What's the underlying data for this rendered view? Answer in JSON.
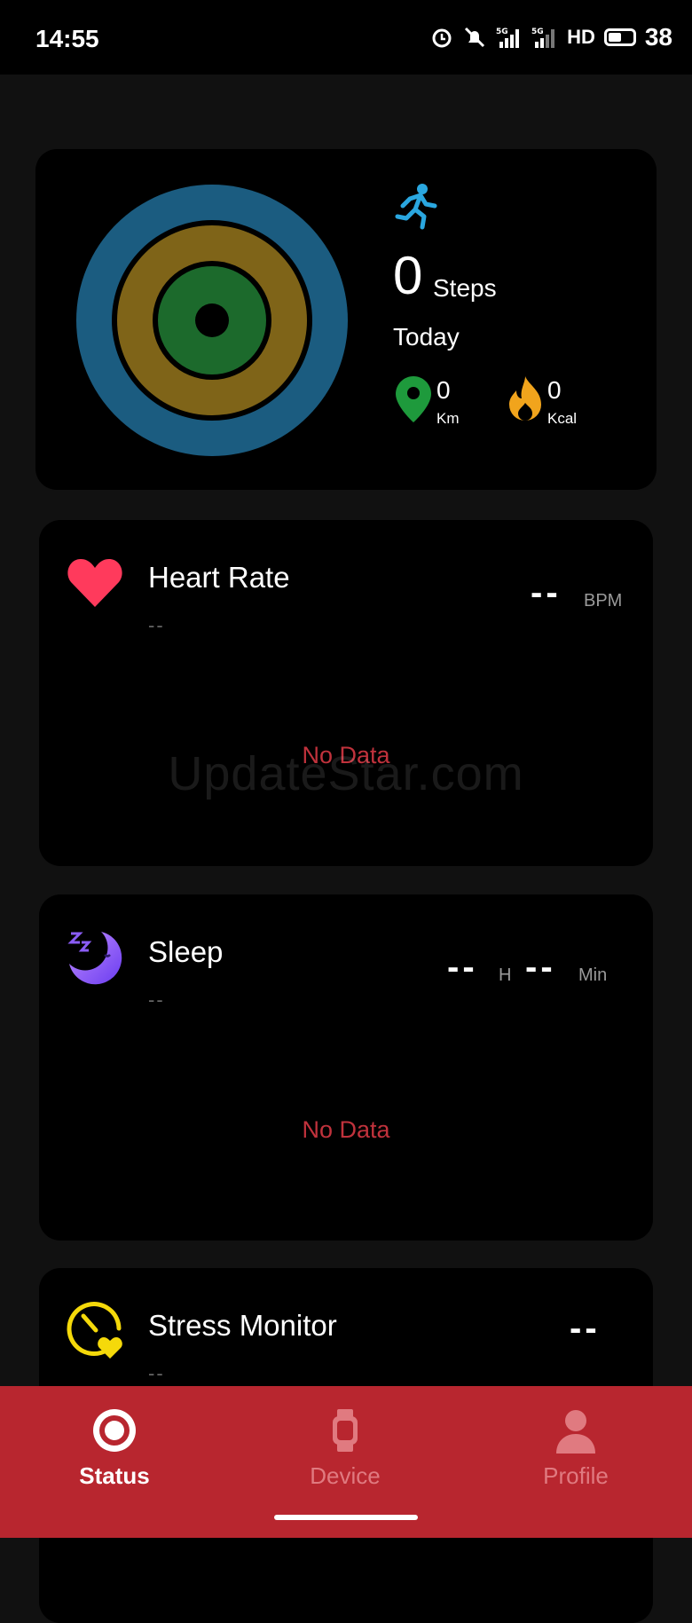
{
  "status_bar": {
    "time": "14:55",
    "network_labels": [
      "5G",
      "5G"
    ],
    "hd_label": "HD",
    "battery_level": "38"
  },
  "activity": {
    "steps_value": "0",
    "steps_unit": "Steps",
    "period": "Today",
    "distance_value": "0",
    "distance_unit": "Km",
    "calories_value": "0",
    "calories_unit": "Kcal",
    "ring_colors": [
      "#1b5c80",
      "#7f6418",
      "#1c6a2c"
    ]
  },
  "heart_rate": {
    "title": "Heart Rate",
    "subtitle": "--",
    "value": "--",
    "unit": "BPM",
    "empty_text": "No Data"
  },
  "sleep": {
    "title": "Sleep",
    "subtitle": "--",
    "hours_value": "--",
    "hours_unit": "H",
    "minutes_value": "--",
    "minutes_unit": "Min",
    "empty_text": "No Data"
  },
  "stress": {
    "title": "Stress Monitor",
    "subtitle": "--",
    "value": "--"
  },
  "watermark": "UpdateStar.com",
  "nav": {
    "status_label": "Status",
    "device_label": "Device",
    "profile_label": "Profile"
  },
  "colors": {
    "accent": "#b8262f",
    "heart": "#ff3a5c",
    "no_data": "#c0323c",
    "run_icon": "#2aa7e0"
  }
}
